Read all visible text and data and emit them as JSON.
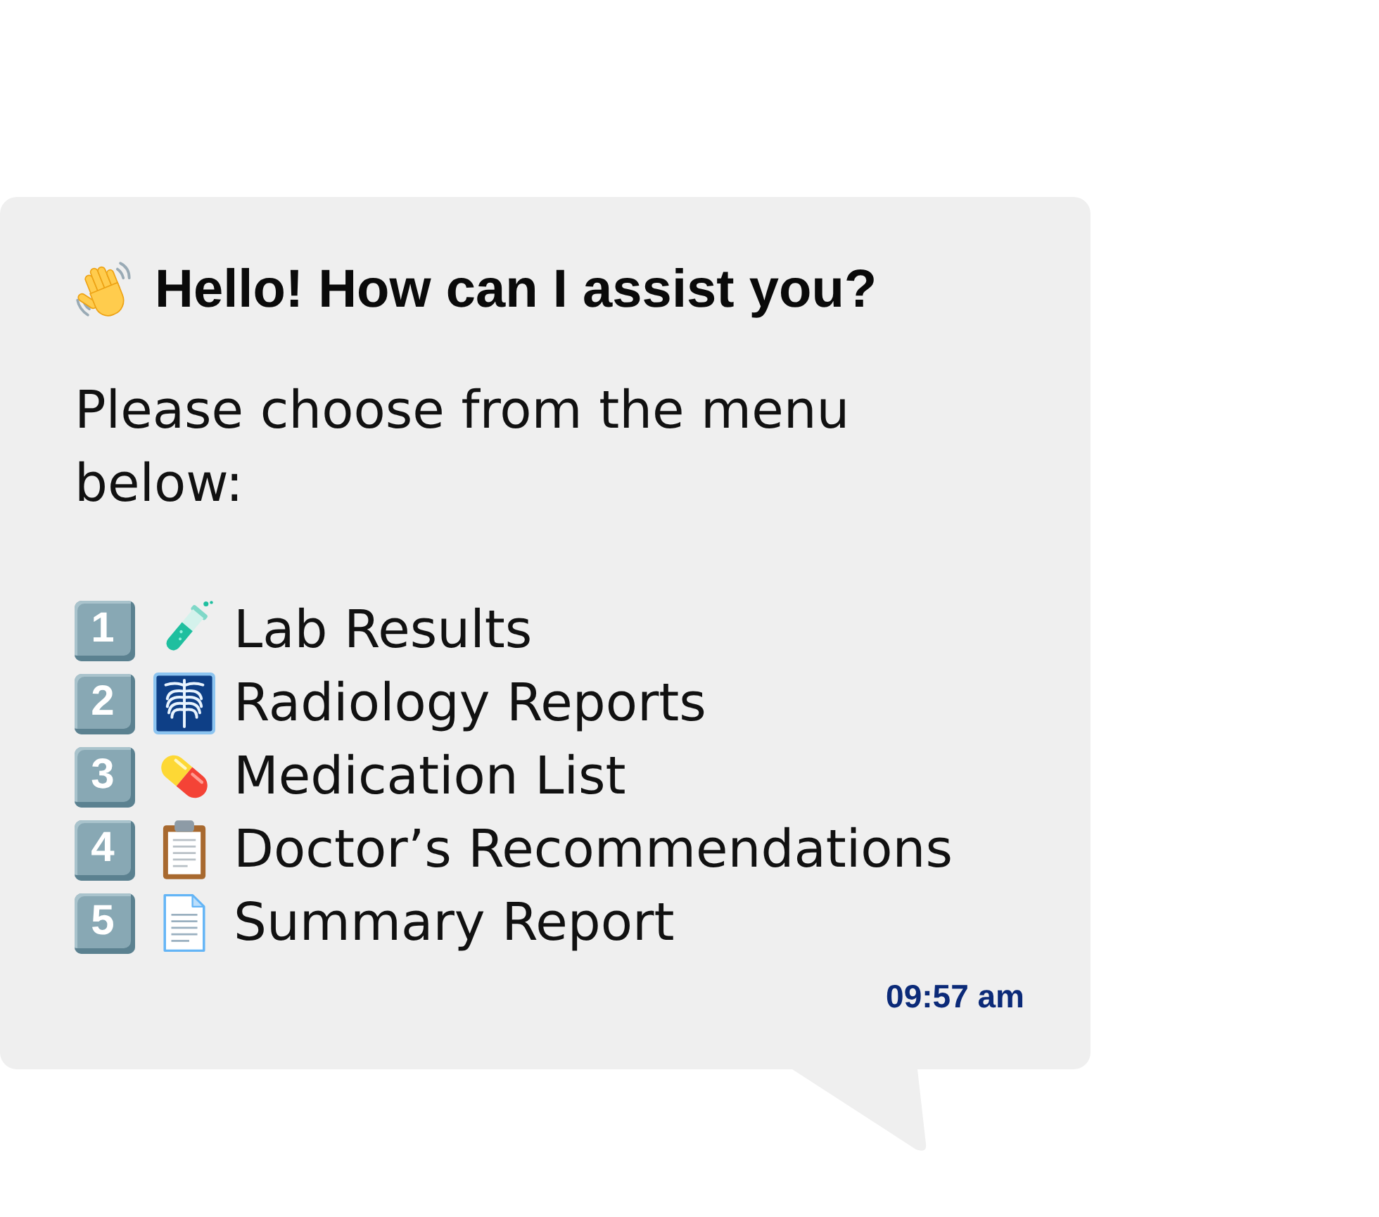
{
  "message": {
    "greeting": "Hello! How can I assist you?",
    "prompt": "Please choose from the menu below:",
    "menu": [
      {
        "number": "1",
        "label": "Lab Results"
      },
      {
        "number": "2",
        "label": "Radiology Reports"
      },
      {
        "number": "3",
        "label": "Medication List"
      },
      {
        "number": "4",
        "label": "Doctor’s Recommendations"
      },
      {
        "number": "5",
        "label": "Summary Report"
      }
    ],
    "time": "09:57 am"
  }
}
